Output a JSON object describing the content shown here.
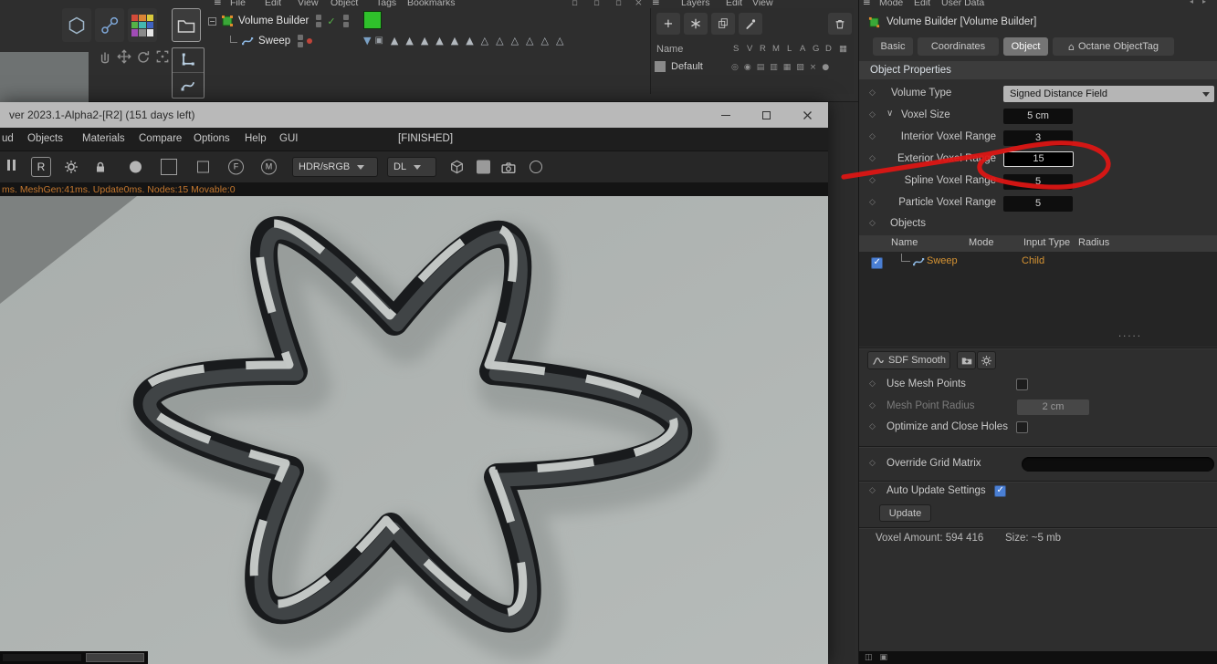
{
  "colors": {
    "annotation_red": "#e01513",
    "accent_orange": "#d79433",
    "check_blue": "#4a7fd4",
    "status_orange": "#c4772e",
    "texture_green": "#2fc12b"
  },
  "c4d_top": {
    "menus_left": [
      "File",
      "Edit",
      "View",
      "Object",
      "Tags",
      "Bookmarks"
    ],
    "menus_right": [
      "Layers",
      "Edit",
      "View"
    ],
    "keyframe_triangles": "▲▲▲▲▲▲△△△△△△"
  },
  "object_manager": {
    "items": [
      {
        "name": "Volume Builder"
      },
      {
        "name": "Sweep"
      }
    ]
  },
  "layer_panel": {
    "name_header": "Name",
    "columns": [
      "S",
      "V",
      "R",
      "M",
      "L",
      "A",
      "G",
      "D"
    ],
    "rows": [
      {
        "label": "Default"
      }
    ]
  },
  "octane_window": {
    "title": "ver 2023.1-Alpha2-[R2] (151 days left)",
    "menu": [
      "ud",
      "Objects",
      "Materials",
      "Compare",
      "Options",
      "Help",
      "GUI"
    ],
    "status_tag": "[FINISHED]",
    "toolbar": {
      "r_button": "R",
      "f_button": "F",
      "m_button": "M",
      "hdr_dropdown": "HDR/sRGB",
      "dl_dropdown": "DL"
    },
    "status_line": "ms. MeshGen:41ms. Update0ms. Nodes:15 Movable:0"
  },
  "attributes_panel": {
    "menus": [
      "Mode",
      "Edit",
      "User Data"
    ],
    "title": "Volume Builder [Volume Builder]",
    "tabs": [
      "Basic",
      "Coordinates",
      "Object",
      "Octane ObjectTag"
    ],
    "section_header": "Object Properties",
    "props": {
      "volume_type_label": "Volume Type",
      "volume_type_value": "Signed Distance Field",
      "voxel_size_label": "Voxel Size",
      "voxel_size_value": "5 cm",
      "interior_label": "Interior Voxel Range",
      "interior_value": "3",
      "exterior_label": "Exterior Voxel Range",
      "exterior_value": "15",
      "spline_label": "Spline Voxel Range",
      "spline_value": "5",
      "particle_label": "Particle Voxel Range",
      "particle_value": "5"
    },
    "objects": {
      "section_label": "Objects",
      "columns": [
        "Name",
        "Mode",
        "Input Type",
        "Radius"
      ],
      "row": {
        "name": "Sweep",
        "input_type": "Child"
      }
    },
    "smooth": {
      "sdf_smooth_button": "SDF Smooth",
      "use_mesh_points_label": "Use Mesh Points",
      "mesh_point_radius_label": "Mesh Point Radius",
      "mesh_point_radius_value": "2 cm",
      "optimize_label": "Optimize and Close Holes"
    },
    "grid": {
      "override_label": "Override Grid Matrix",
      "auto_update_label": "Auto Update Settings",
      "update_button": "Update"
    },
    "footer": {
      "voxel_amount": "Voxel Amount: 594 416",
      "size": "Size: ~5 mb"
    }
  }
}
